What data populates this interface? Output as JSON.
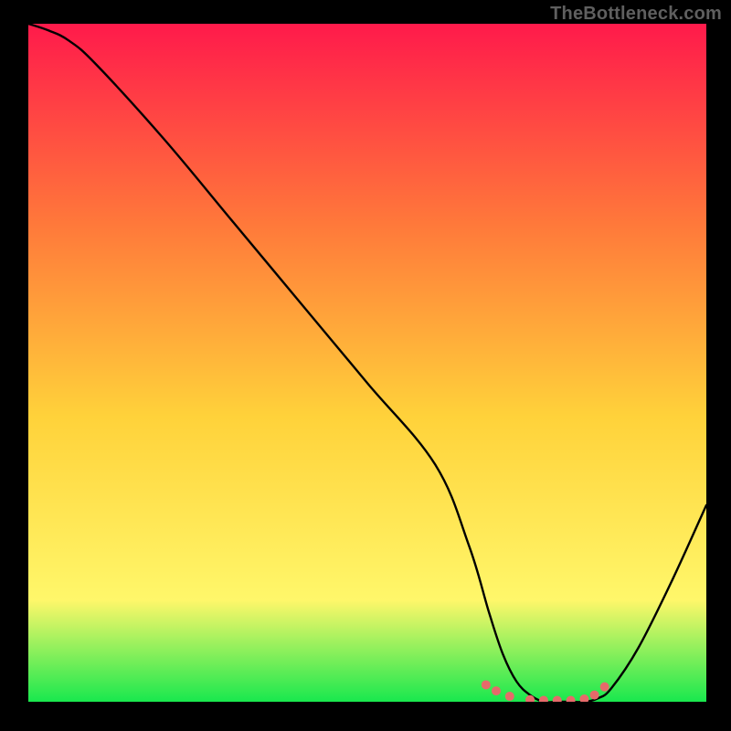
{
  "watermark": "TheBottleneck.com",
  "gradient": {
    "top": "#ff1a4b",
    "q1": "#ff7a3a",
    "mid": "#ffd23a",
    "q3": "#fff76a",
    "bot": "#19e84e"
  },
  "curve_color": "#000000",
  "marker_color": "#e66a6a",
  "chart_data": {
    "type": "line",
    "title": "",
    "xlabel": "",
    "ylabel": "",
    "xlim": [
      0,
      100
    ],
    "ylim": [
      0,
      100
    ],
    "grid": false,
    "series": [
      {
        "name": "bottleneck-curve",
        "x": [
          0,
          3,
          6,
          10,
          20,
          30,
          40,
          50,
          60,
          65,
          68,
          70,
          72,
          74,
          76,
          78,
          80,
          82,
          84,
          86,
          90,
          95,
          100
        ],
        "y": [
          100,
          99,
          97.5,
          94,
          83,
          71,
          59,
          47,
          35,
          23,
          13,
          7,
          3,
          1,
          0,
          0,
          0,
          0,
          0.5,
          2,
          8,
          18,
          29
        ]
      }
    ],
    "markers": {
      "name": "bottleneck-optimal-markers",
      "x": [
        67.5,
        69,
        71,
        74,
        76,
        78,
        80,
        82,
        83.5,
        85
      ],
      "y": [
        2.5,
        1.6,
        0.8,
        0.3,
        0.2,
        0.2,
        0.2,
        0.4,
        1.0,
        2.2
      ]
    }
  }
}
